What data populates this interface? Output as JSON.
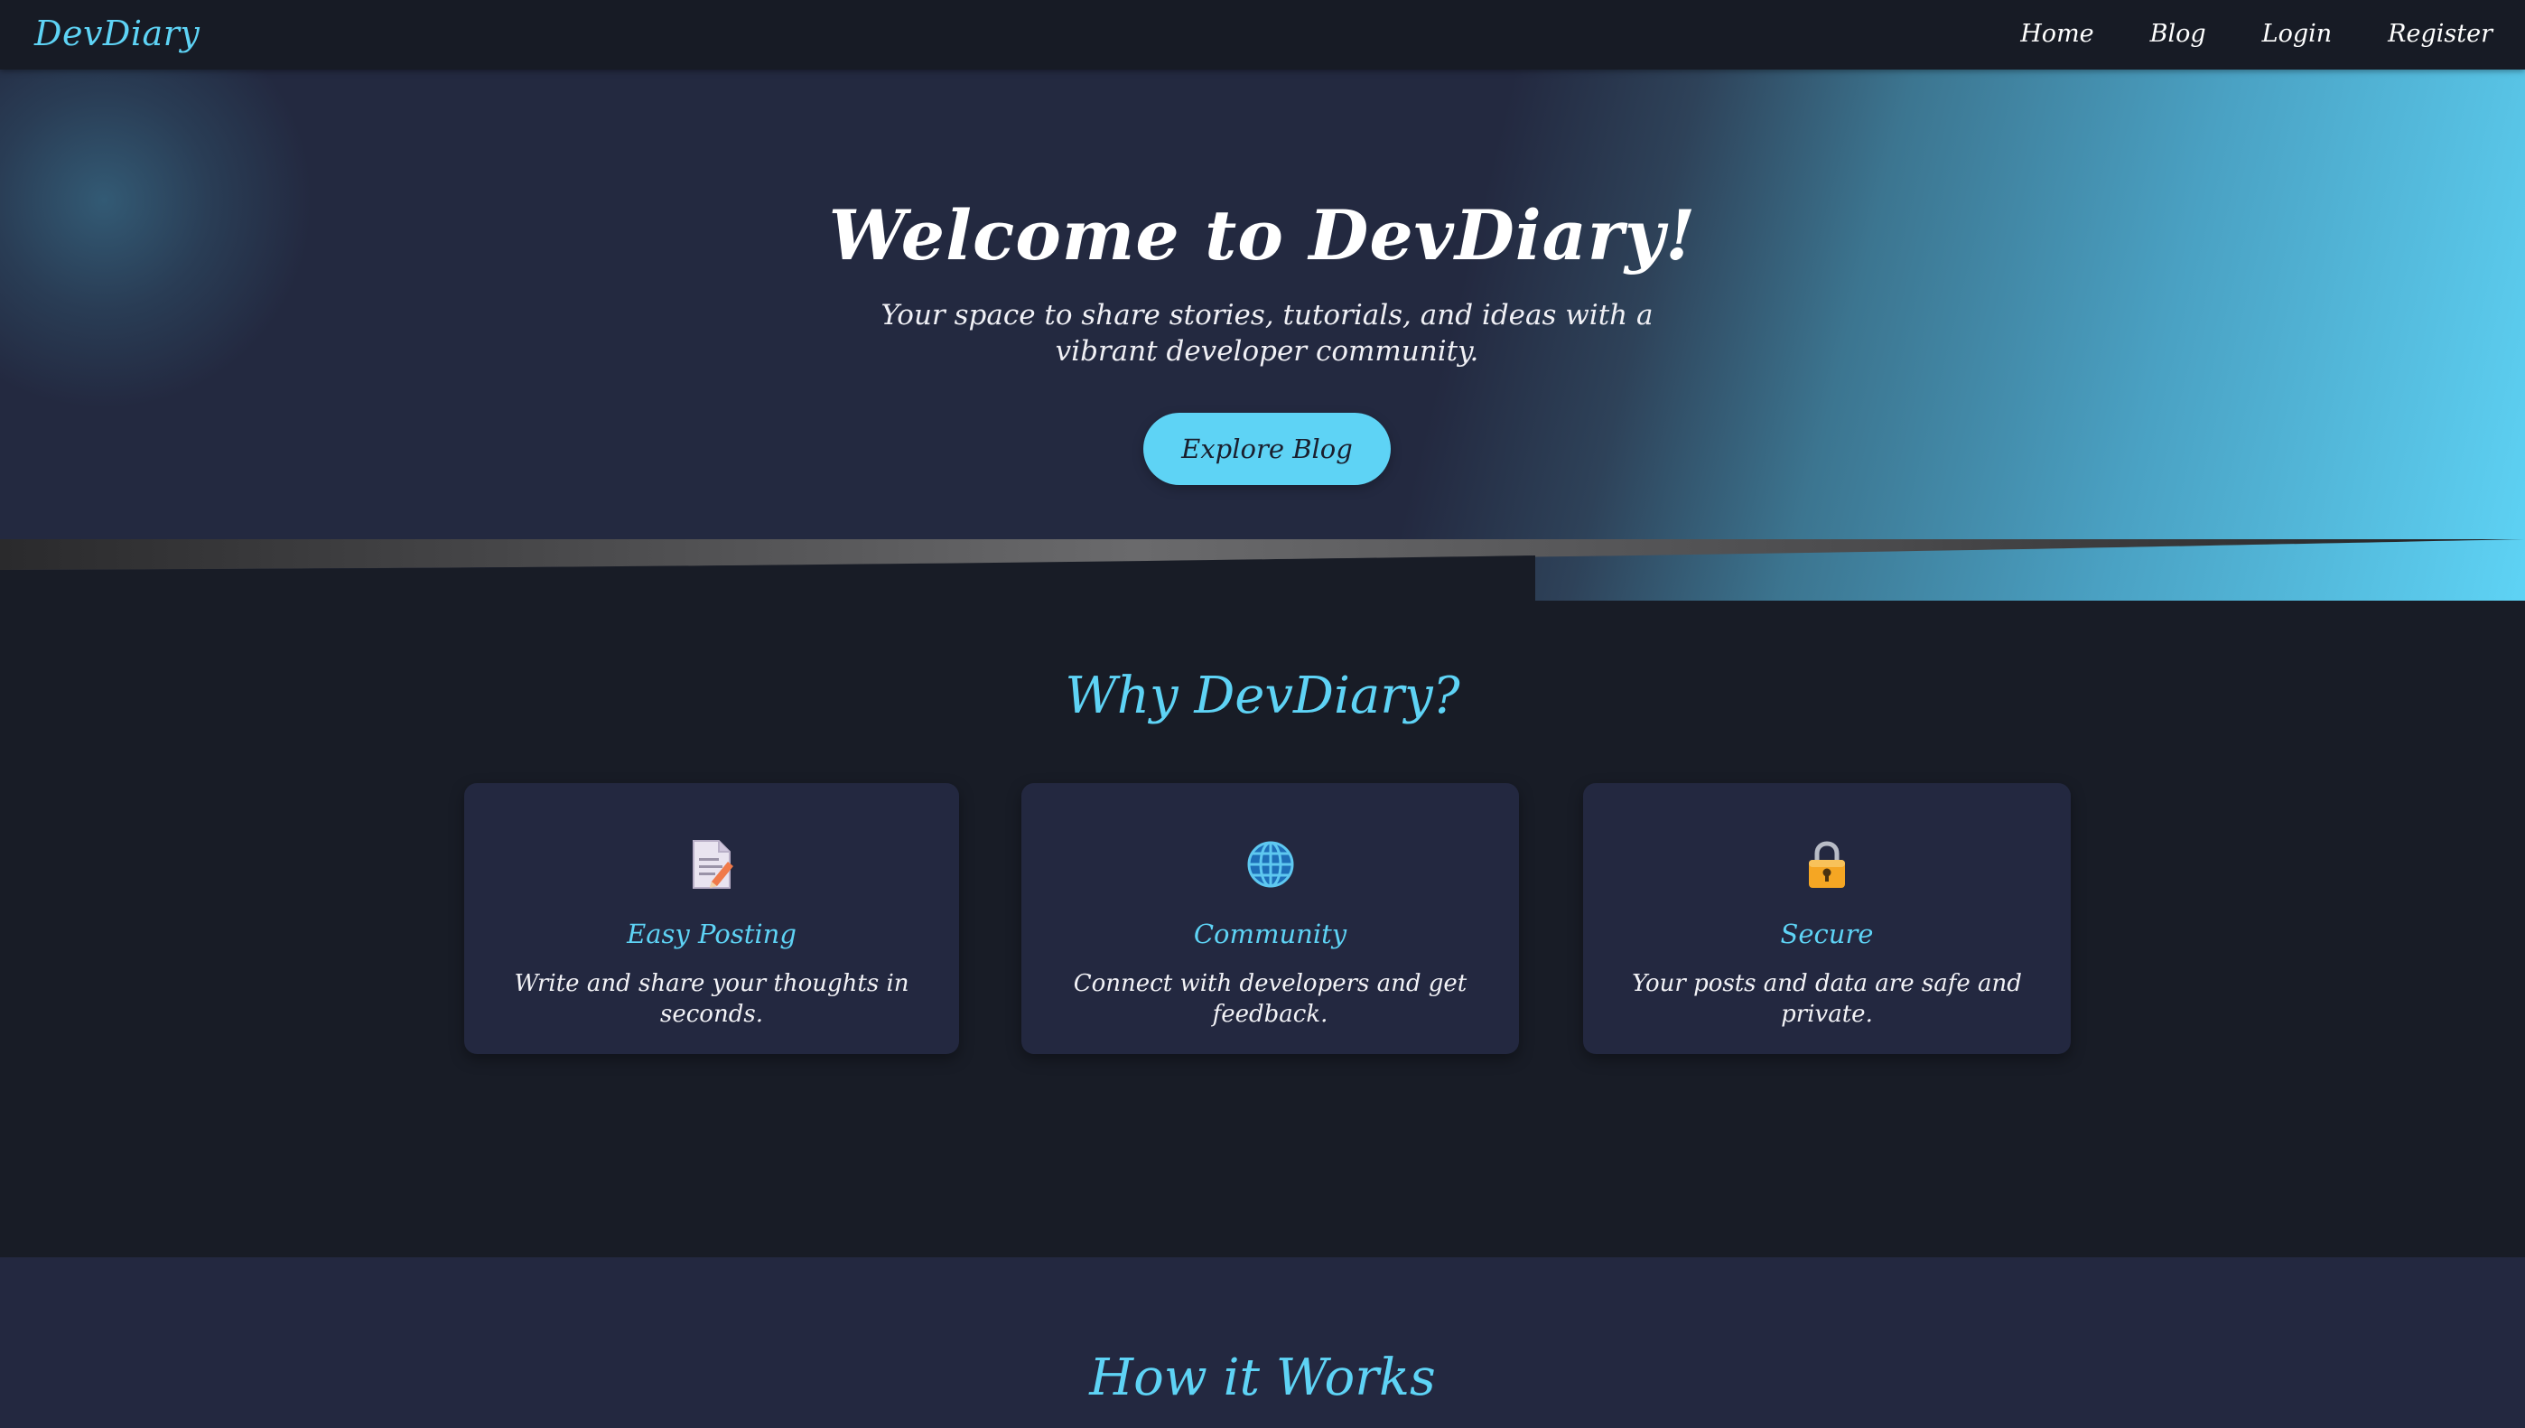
{
  "navbar": {
    "brand": "DevDiary",
    "links": [
      "Home",
      "Blog",
      "Login",
      "Register"
    ]
  },
  "hero": {
    "title": "Welcome to DevDiary!",
    "subtitle": "Your space to share stories, tutorials, and ideas with a vibrant developer community.",
    "button_label": "Explore Blog"
  },
  "why": {
    "title": "Why DevDiary?",
    "features": [
      {
        "icon": "memo-icon",
        "title": "Easy Posting",
        "text": "Write and share your thoughts in seconds."
      },
      {
        "icon": "globe-icon",
        "title": "Community",
        "text": "Connect with developers and get feedback."
      },
      {
        "icon": "lock-icon",
        "title": "Secure",
        "text": "Your posts and data are safe and private."
      }
    ]
  },
  "how": {
    "title": "How it Works"
  },
  "colors": {
    "accent": "#5ed3f5",
    "background": "#181c26",
    "card": "#232840"
  }
}
